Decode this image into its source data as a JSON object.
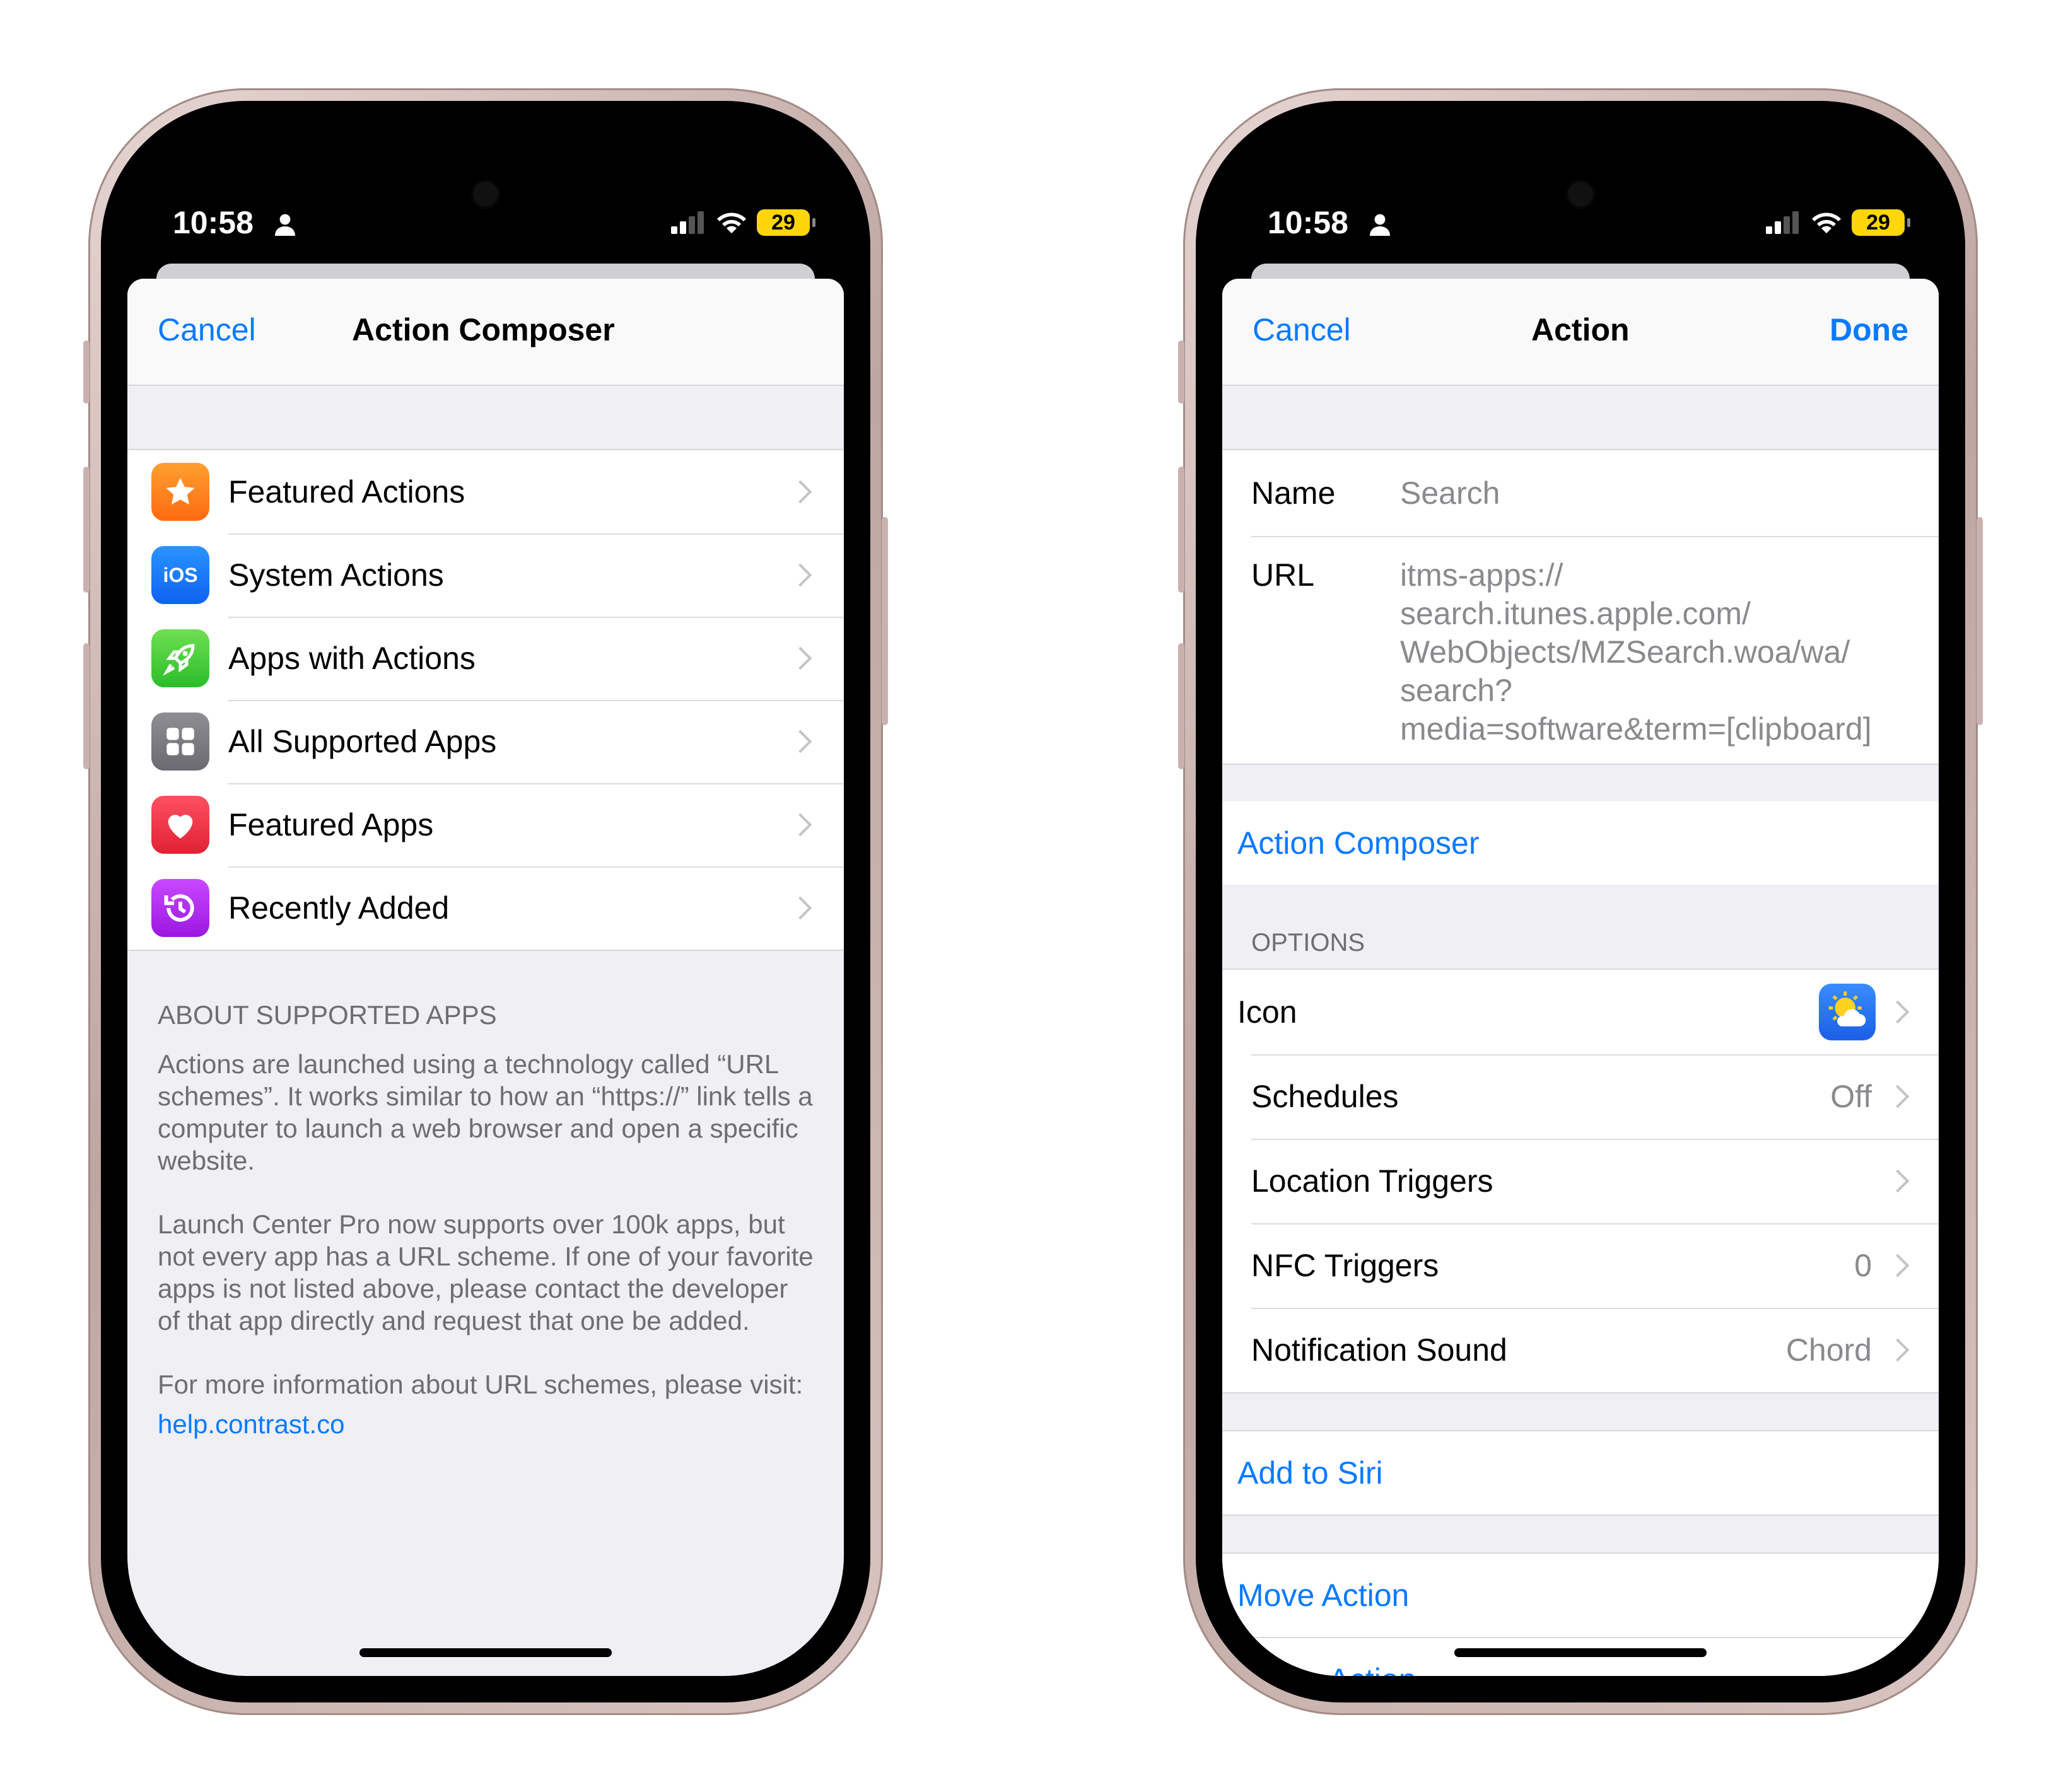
{
  "left_screen": {
    "status": {
      "time": "10:58",
      "battery": "29"
    },
    "nav": {
      "cancel": "Cancel",
      "title": "Action Composer"
    },
    "items": [
      {
        "label": "Featured Actions",
        "icon": "star-icon",
        "color": "#ff8a1f"
      },
      {
        "label": "System Actions",
        "icon": "ios-icon",
        "color": "#1a7cff",
        "icon_text": "iOS"
      },
      {
        "label": "Apps with Actions",
        "icon": "rocket-icon",
        "color": "#4cd138"
      },
      {
        "label": "All Supported Apps",
        "icon": "grid-icon",
        "color": "#7a7a80"
      },
      {
        "label": "Featured Apps",
        "icon": "heart-icon",
        "color": "#ee3645"
      },
      {
        "label": "Recently Added",
        "icon": "clock-icon",
        "color": "#b42cf0"
      }
    ],
    "about": {
      "heading": "ABOUT SUPPORTED APPS",
      "p1": "Actions are launched using a technology called “URL schemes”. It works similar to how an “https://” link tells a computer to launch a web browser and open a specific website.",
      "p2": "Launch Center Pro now supports over 100k apps, but not every app has a URL scheme. If one of your favorite apps is not listed above, please contact the developer of that app directly and request that one be added.",
      "p3": "For more information about URL schemes, please visit:",
      "link": "help.contrast.co"
    }
  },
  "right_screen": {
    "status": {
      "time": "10:58",
      "battery": "29"
    },
    "nav": {
      "cancel": "Cancel",
      "title": "Action",
      "done": "Done"
    },
    "name": {
      "label": "Name",
      "value": "Search"
    },
    "url": {
      "label": "URL",
      "value": "itms-apps://\nsearch.itunes.apple.com/\nWebObjects/MZSearch.woa/wa/\nsearch?\nmedia=software&term=[clipboard]"
    },
    "action_composer": "Action Composer",
    "options_header": "OPTIONS",
    "options": {
      "icon": {
        "label": "Icon",
        "icon": "weather-icon"
      },
      "schedules": {
        "label": "Schedules",
        "value": "Off"
      },
      "location": {
        "label": "Location Triggers",
        "value": ""
      },
      "nfc": {
        "label": "NFC Triggers",
        "value": "0"
      },
      "sound": {
        "label": "Notification Sound",
        "value": "Chord"
      }
    },
    "add_to_siri": "Add to Siri",
    "move_action": "Move Action",
    "share_action": "Share Action"
  }
}
